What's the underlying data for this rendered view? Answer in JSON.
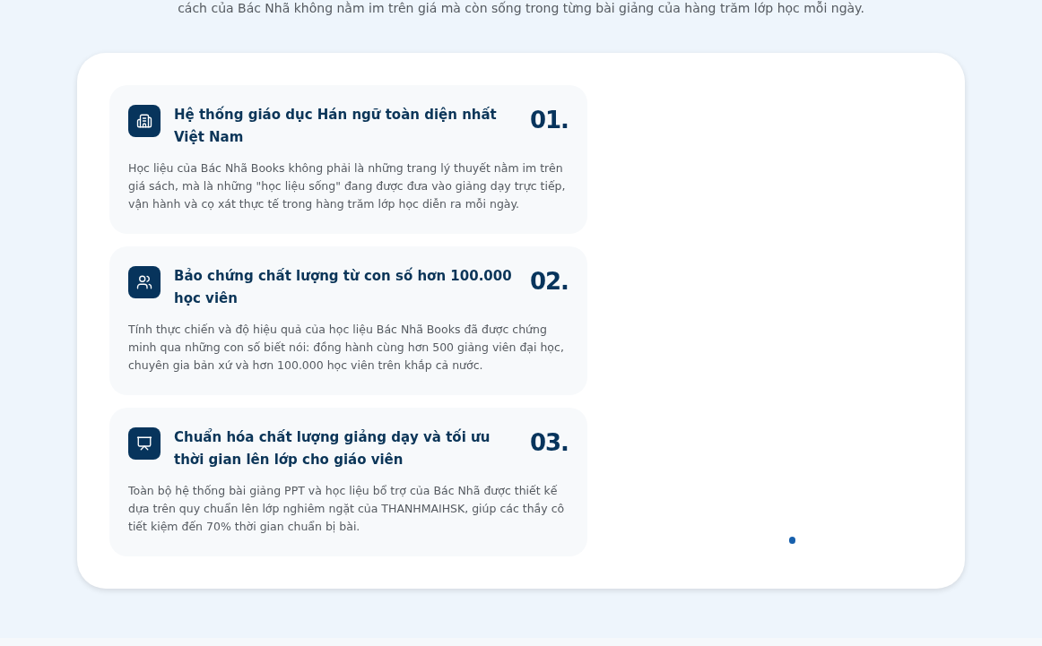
{
  "intro": {
    "text": "cách của Bác Nhã không nằm im trên giá mà còn sống trong từng bài giảng của hàng trăm lớp học mỗi ngày."
  },
  "features": [
    {
      "title": "Hệ thống giáo dục Hán ngữ toàn diện nhất Việt Nam",
      "number": "01.",
      "description": "Học liệu của Bác Nhã Books không phải là những trang lý thuyết nằm im trên giá sách, mà là những \"học liệu sống\" đang được đưa vào giảng dạy trực tiếp, vận hành và cọ xát thực tế trong hàng trăm lớp học diễn ra mỗi ngày."
    },
    {
      "title": "Bảo chứng chất lượng từ con số hơn 100.000 học viên",
      "number": "02.",
      "description": "Tính thực chiến và độ hiệu quả của học liệu Bác Nhã Books đã được chứng minh qua những con số biết nói: đồng hành cùng hơn 500 giảng viên đại học, chuyên gia bản xứ và hơn 100.000 học viên trên khắp cả nước."
    },
    {
      "title": "Chuẩn hóa chất lượng giảng dạy và tối ưu thời gian lên lớp cho giáo viên",
      "number": "03.",
      "description": "Toàn bộ hệ thống bài giảng PPT và học liệu bổ trợ của Bác Nhã được thiết kế dựa trên quy chuẩn lên lớp nghiêm ngặt của THANHMAIHSK, giúp các thầy cô tiết kiệm đến 70% thời gian chuẩn bị bài."
    }
  ]
}
